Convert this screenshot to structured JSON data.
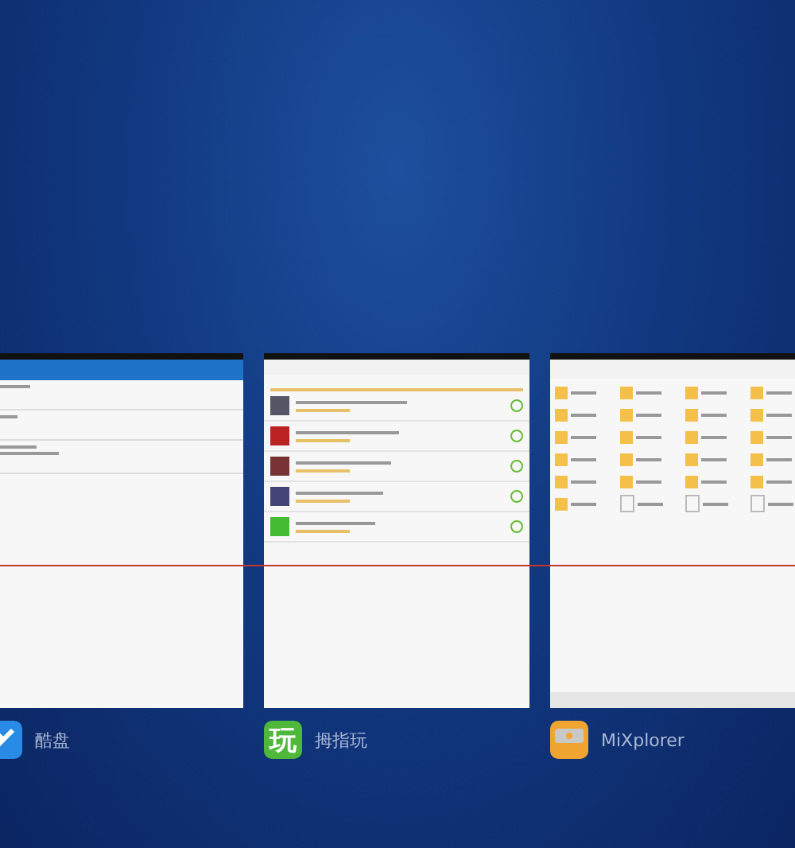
{
  "recent_apps": [
    {
      "kind": "list",
      "label": "酷盘"
    },
    {
      "kind": "downloads",
      "label": "拇指玩",
      "icon_text": "玩"
    },
    {
      "kind": "files",
      "label": "MiXplorer"
    }
  ]
}
